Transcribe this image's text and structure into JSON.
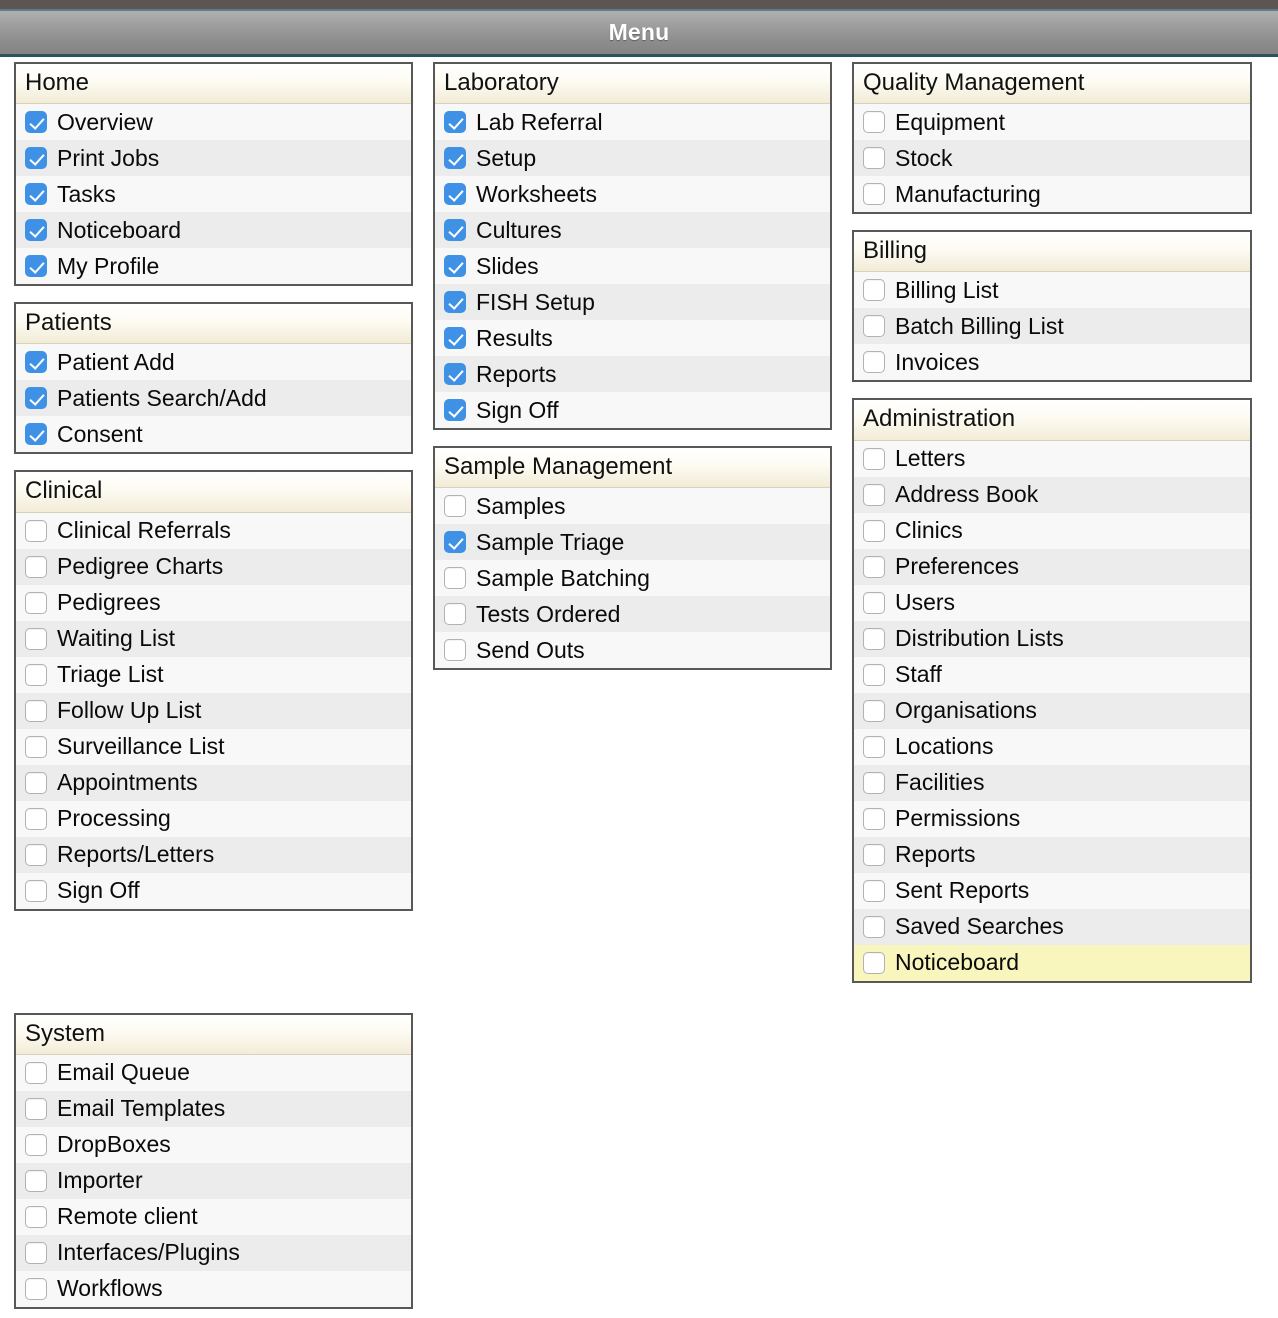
{
  "window": {
    "toolbar_title": "Menu",
    "accent_checked_color": "#3f91e5",
    "highlight_row_color": "#f8f5bd",
    "panel_header_color": "#f2ecd7",
    "toolbar_bg_color": "#8d8d8d"
  },
  "columns": [
    {
      "id": "column-left",
      "panels": [
        {
          "title": "Home",
          "items": [
            {
              "label": "Overview",
              "checked": true,
              "highlighted": false
            },
            {
              "label": "Print Jobs",
              "checked": true,
              "highlighted": false
            },
            {
              "label": "Tasks",
              "checked": true,
              "highlighted": false
            },
            {
              "label": "Noticeboard",
              "checked": true,
              "highlighted": false
            },
            {
              "label": "My Profile",
              "checked": true,
              "highlighted": false
            }
          ]
        },
        {
          "title": "Patients",
          "items": [
            {
              "label": "Patient Add",
              "checked": true,
              "highlighted": false
            },
            {
              "label": "Patients Search/Add",
              "checked": true,
              "highlighted": false
            },
            {
              "label": "Consent",
              "checked": true,
              "highlighted": false
            }
          ]
        },
        {
          "title": "Clinical",
          "items": [
            {
              "label": "Clinical Referrals",
              "checked": false,
              "highlighted": false
            },
            {
              "label": "Pedigree Charts",
              "checked": false,
              "highlighted": false
            },
            {
              "label": "Pedigrees",
              "checked": false,
              "highlighted": false
            },
            {
              "label": "Waiting List",
              "checked": false,
              "highlighted": false
            },
            {
              "label": "Triage List",
              "checked": false,
              "highlighted": false
            },
            {
              "label": "Follow Up List",
              "checked": false,
              "highlighted": false
            },
            {
              "label": "Surveillance List",
              "checked": false,
              "highlighted": false
            },
            {
              "label": "Appointments",
              "checked": false,
              "highlighted": false
            },
            {
              "label": "Processing",
              "checked": false,
              "highlighted": false
            },
            {
              "label": "Reports/Letters",
              "checked": false,
              "highlighted": false
            },
            {
              "label": "Sign Off",
              "checked": false,
              "highlighted": false
            }
          ]
        },
        {
          "title": "System",
          "spacer_before": true,
          "items": [
            {
              "label": "Email Queue",
              "checked": false,
              "highlighted": false
            },
            {
              "label": "Email Templates",
              "checked": false,
              "highlighted": false
            },
            {
              "label": "DropBoxes",
              "checked": false,
              "highlighted": false
            },
            {
              "label": "Importer",
              "checked": false,
              "highlighted": false
            },
            {
              "label": "Remote client",
              "checked": false,
              "highlighted": false
            },
            {
              "label": "Interfaces/Plugins",
              "checked": false,
              "highlighted": false
            },
            {
              "label": "Workflows",
              "checked": false,
              "highlighted": false
            }
          ]
        }
      ]
    },
    {
      "id": "column-middle",
      "panels": [
        {
          "title": "Laboratory",
          "items": [
            {
              "label": "Lab Referral",
              "checked": true,
              "highlighted": false
            },
            {
              "label": "Setup",
              "checked": true,
              "highlighted": false
            },
            {
              "label": "Worksheets",
              "checked": true,
              "highlighted": false
            },
            {
              "label": "Cultures",
              "checked": true,
              "highlighted": false
            },
            {
              "label": "Slides",
              "checked": true,
              "highlighted": false
            },
            {
              "label": "FISH Setup",
              "checked": true,
              "highlighted": false
            },
            {
              "label": "Results",
              "checked": true,
              "highlighted": false
            },
            {
              "label": "Reports",
              "checked": true,
              "highlighted": false
            },
            {
              "label": "Sign Off",
              "checked": true,
              "highlighted": false
            }
          ]
        },
        {
          "title": "Sample Management",
          "items": [
            {
              "label": "Samples",
              "checked": false,
              "highlighted": false
            },
            {
              "label": "Sample Triage",
              "checked": true,
              "highlighted": false
            },
            {
              "label": "Sample Batching",
              "checked": false,
              "highlighted": false
            },
            {
              "label": "Tests Ordered",
              "checked": false,
              "highlighted": false
            },
            {
              "label": "Send Outs",
              "checked": false,
              "highlighted": false
            }
          ]
        }
      ]
    },
    {
      "id": "column-right",
      "panels": [
        {
          "title": "Quality Management",
          "items": [
            {
              "label": "Equipment",
              "checked": false,
              "highlighted": false
            },
            {
              "label": "Stock",
              "checked": false,
              "highlighted": false
            },
            {
              "label": "Manufacturing",
              "checked": false,
              "highlighted": false
            }
          ]
        },
        {
          "title": "Billing",
          "items": [
            {
              "label": "Billing List",
              "checked": false,
              "highlighted": false
            },
            {
              "label": "Batch Billing List",
              "checked": false,
              "highlighted": false
            },
            {
              "label": "Invoices",
              "checked": false,
              "highlighted": false
            }
          ]
        },
        {
          "title": "Administration",
          "items": [
            {
              "label": "Letters",
              "checked": false,
              "highlighted": false
            },
            {
              "label": "Address Book",
              "checked": false,
              "highlighted": false
            },
            {
              "label": "Clinics",
              "checked": false,
              "highlighted": false
            },
            {
              "label": "Preferences",
              "checked": false,
              "highlighted": false
            },
            {
              "label": "Users",
              "checked": false,
              "highlighted": false
            },
            {
              "label": "Distribution Lists",
              "checked": false,
              "highlighted": false
            },
            {
              "label": "Staff",
              "checked": false,
              "highlighted": false
            },
            {
              "label": "Organisations",
              "checked": false,
              "highlighted": false
            },
            {
              "label": "Locations",
              "checked": false,
              "highlighted": false
            },
            {
              "label": "Facilities",
              "checked": false,
              "highlighted": false
            },
            {
              "label": "Permissions",
              "checked": false,
              "highlighted": false
            },
            {
              "label": "Reports",
              "checked": false,
              "highlighted": false
            },
            {
              "label": "Sent Reports",
              "checked": false,
              "highlighted": false
            },
            {
              "label": "Saved Searches",
              "checked": false,
              "highlighted": false
            },
            {
              "label": "Noticeboard",
              "checked": false,
              "highlighted": true
            }
          ]
        }
      ]
    }
  ]
}
